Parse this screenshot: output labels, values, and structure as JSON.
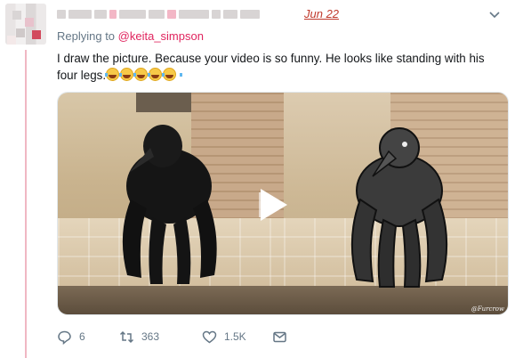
{
  "tweet": {
    "date": "Jun 22",
    "replying_prefix": "Replying to ",
    "replying_handle": "@keita_simpson",
    "body_line1": "I draw the picture. Because your video is so funny. He looks like standing with his",
    "body_line2": "four legs.",
    "emoji_count": 5,
    "emoji_name": "face-with-tears-of-joy",
    "media_watermark": "@Furcrow"
  },
  "actions": {
    "replies": "6",
    "retweets": "363",
    "likes": "1.5K"
  },
  "icons": {
    "reply": "reply-icon",
    "retweet": "retweet-icon",
    "like": "heart-icon",
    "dm": "envelope-icon",
    "menu": "chevron-down-icon"
  },
  "colors": {
    "accent": "#e0245e",
    "thread_line": "#f0b7c3",
    "muted": "#657786",
    "date": "#c0392b"
  }
}
